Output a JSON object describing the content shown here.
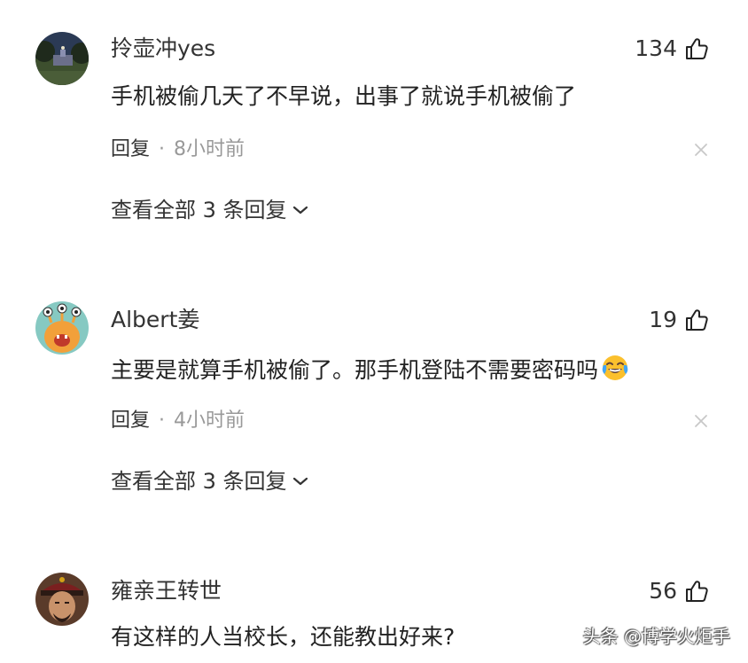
{
  "comments": [
    {
      "username": "拎壶冲yes",
      "likes": "134",
      "text": "手机被偷几天了不早说，出事了就说手机被偷了",
      "reply_label": "回复",
      "separator": "·",
      "time": "8小时前",
      "view_replies": "查看全部 3 条回复",
      "avatar": "night-landscape-avatar"
    },
    {
      "username": "Albert姜",
      "likes": "19",
      "text": "主要是就算手机被偷了。那手机登陆不需要密码吗",
      "emoji": "crying-laughing-emoji",
      "reply_label": "回复",
      "separator": "·",
      "time": "4小时前",
      "view_replies": "查看全部 3 条回复",
      "avatar": "cartoon-monster-avatar"
    },
    {
      "username": "雍亲王转世",
      "likes": "56",
      "text": "有这样的人当校长，还能教出好来?",
      "avatar": "qing-prince-portrait-avatar"
    }
  ],
  "watermark": "头条 @博学火炬手",
  "colors": {
    "text_primary": "#222222",
    "text_secondary": "#999999",
    "background": "#ffffff"
  }
}
